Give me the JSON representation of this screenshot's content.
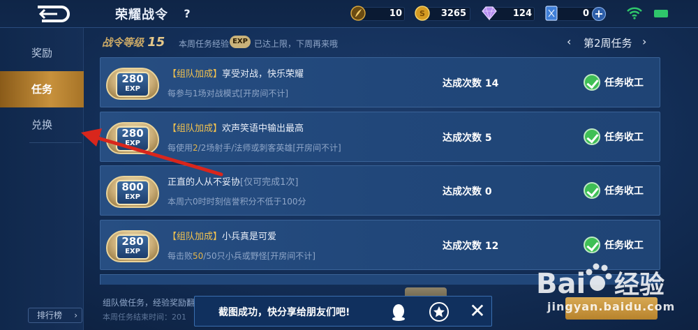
{
  "header": {
    "title": "荣耀战令",
    "help_label": "?",
    "resources": [
      {
        "icon": "feather-token-icon",
        "value": "10"
      },
      {
        "icon": "gold-coin-icon",
        "value": "3265"
      },
      {
        "icon": "diamond-icon",
        "value": "124"
      },
      {
        "icon": "ticket-card-icon",
        "value": "0"
      }
    ],
    "add_label": "+"
  },
  "sidebar": {
    "items": [
      {
        "label": "奖励",
        "active": false
      },
      {
        "label": "任务",
        "active": true
      },
      {
        "label": "兑换",
        "active": false
      }
    ],
    "rank_button": "排行榜",
    "rank_chevron": "›"
  },
  "summary": {
    "level_prefix": "战令等级",
    "level_value": "15",
    "weekly_exp_label": "本周任务经验",
    "exp_badge": "EXP",
    "capped_text": "已达上限，下周再来哦",
    "week_label": "第2周任务",
    "prev": "‹",
    "next": "›"
  },
  "tasks": [
    {
      "exp": "280",
      "exp_unit": "EXP",
      "tag": "【组队加成】",
      "title": "享受对战，快乐荣耀",
      "desc_a": "每参与1场对战模式[开房间不计]",
      "desc_hl": "",
      "desc_b": "",
      "count": "达成次数 14",
      "status": "任务收工"
    },
    {
      "exp": "280",
      "exp_unit": "EXP",
      "tag": "【组队加成】",
      "title": "欢声笑语中输出最高",
      "desc_a": "每使用",
      "desc_hl": "2",
      "desc_b": "/2场射手/法师或刺客英雄[开房间不计]",
      "count": "达成次数 5",
      "status": "任务收工"
    },
    {
      "exp": "800",
      "exp_unit": "EXP",
      "tag": "",
      "title": "正直的人从不妥协",
      "title_suffix": "[仅可完成1次]",
      "desc_a": "本周六0时时刻信誉积分不低于100分",
      "desc_hl": "",
      "desc_b": "",
      "count": "达成次数 0",
      "status": "任务收工"
    },
    {
      "exp": "280",
      "exp_unit": "EXP",
      "tag": "【组队加成】",
      "title": "小兵真是可爱",
      "desc_a": "每击败",
      "desc_hl": "50",
      "desc_b": "/50只小兵或野怪[开房间不计]",
      "count": "达成次数 12",
      "status": "任务收工"
    }
  ],
  "footer": {
    "note": "组队做任务，经验奖励翻倍",
    "end_time": "本周任务结束时间：201"
  },
  "toast": {
    "text": "截图成功，快分享给朋友们吧!",
    "close": "✕"
  },
  "watermark": {
    "url": "jingyan.baidu.com"
  },
  "colors": {
    "accent_gold": "#f2c24f",
    "active_tab": "#c7913c",
    "status_green": "#3fbf55",
    "annotation_red": "#d9261c"
  }
}
